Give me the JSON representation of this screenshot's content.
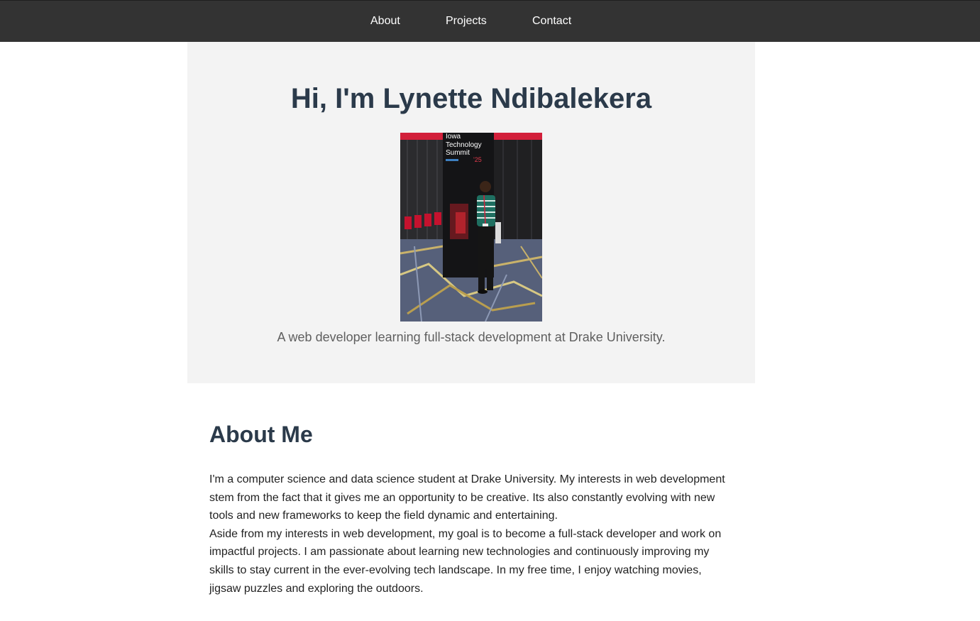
{
  "nav": {
    "items": [
      {
        "label": "About"
      },
      {
        "label": "Projects"
      },
      {
        "label": "Contact"
      }
    ]
  },
  "hero": {
    "title": "Hi, I'm Lynette Ndibalekera",
    "tagline": "A web developer learning full-stack development at Drake University.",
    "photo_sign": {
      "line1": "Iowa",
      "line2": "Technology",
      "line3": "Summit",
      "year": "'25"
    }
  },
  "about": {
    "heading": "About Me",
    "paragraph1": "I'm a computer science and data science student at Drake University. My interests in web development stem from the fact that it gives me an opportunity to be creative. Its also constantly evolving with new tools and new frameworks to keep the field dynamic and entertaining.",
    "paragraph2": "Aside from my interests in web development, my goal is to become a full-stack developer and work on impactful projects. I am passionate about learning new technologies and continuously improving my skills to stay current in the ever-evolving tech landscape. In my free time, I enjoy watching movies, jigsaw puzzles and exploring the outdoors."
  },
  "colors": {
    "nav_bg": "#333333",
    "hero_bg": "#f3f3f3",
    "heading": "#2b3a4a",
    "tagline": "#5f5f5f"
  }
}
